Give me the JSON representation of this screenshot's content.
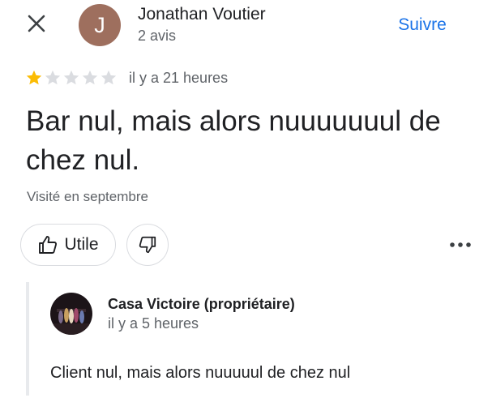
{
  "header": {
    "avatar_initial": "J",
    "avatar_color": "#9e6f5e",
    "author_name": "Jonathan Voutier",
    "author_meta": "2 avis",
    "follow_label": "Suivre",
    "accent_color": "#1a73e8",
    "icons": {
      "close": "close-icon"
    }
  },
  "review": {
    "rating": 1,
    "rating_max": 5,
    "star_filled_color": "#fbbc04",
    "star_empty_color": "#dadce0",
    "time": "il y a 21 heures",
    "text": "Bar nul, mais alors nuuuuuuul de chez nul.",
    "visited": "Visité en septembre"
  },
  "actions": {
    "useful_label": "Utile",
    "icons": {
      "useful": "thumbs-up-icon",
      "not_useful": "thumbs-down-icon",
      "more": "more-horizontal-icon"
    }
  },
  "owner_reply": {
    "name": "Casa Victoire (propriétaire)",
    "time": "il y a 5 heures",
    "text": "Client nul, mais alors nuuuuul de chez nul"
  }
}
